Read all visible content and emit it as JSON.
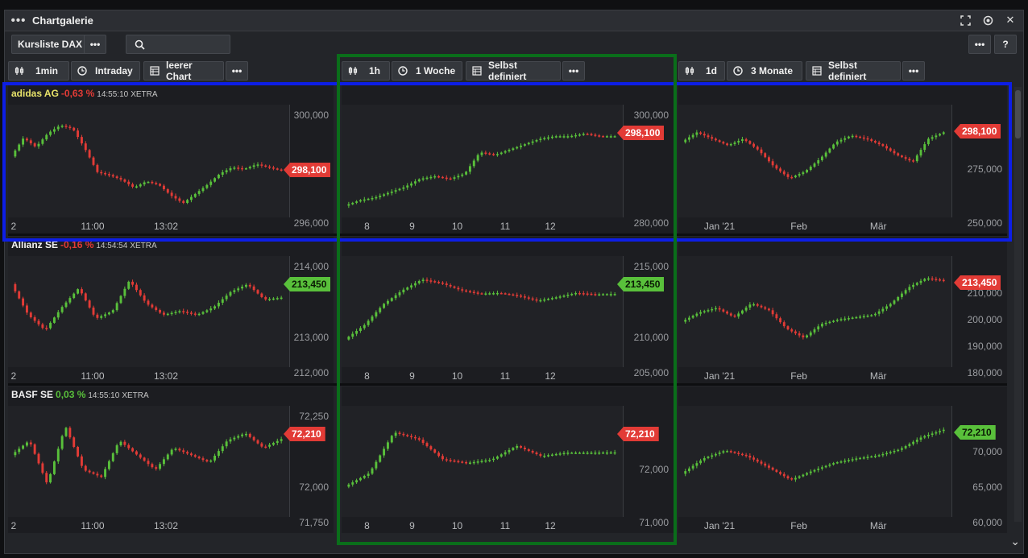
{
  "window": {
    "title": "Chartgalerie"
  },
  "toolbar": {
    "list_label": "Kursliste DAX",
    "more_label": "•••",
    "help_label": "?"
  },
  "search": {
    "placeholder": ""
  },
  "columns": [
    {
      "interval": "1min",
      "range": "Intraday",
      "layout": "leerer Chart",
      "more": "•••"
    },
    {
      "interval": "1h",
      "range": "1 Woche",
      "layout": "Selbst definiert",
      "more": "•••"
    },
    {
      "interval": "1d",
      "range": "3 Monate",
      "layout": "Selbst definiert",
      "more": "•••"
    }
  ],
  "colors": {
    "up": "#59c03b",
    "down": "#e23b36",
    "background": "#232529",
    "highlight_row": "#0d1ee6",
    "highlight_column": "#0a6e1a"
  },
  "rows": [
    {
      "name": "adidas AG",
      "change": "-0,63 %",
      "change_dir": "down",
      "time": "14:55:10",
      "exchange": "XETRA",
      "charts": [
        {
          "y_labels": [
            "300,000",
            "298,100",
            "296,000"
          ],
          "x_labels": [
            "2",
            "11:00",
            "13:02"
          ],
          "last": "298,100",
          "last_dir": "down",
          "ylim": [
            295.5,
            301.5
          ],
          "series": [
            299.0,
            300.2,
            299.6,
            300.5,
            301.0,
            300.8,
            299.5,
            298.0,
            297.8,
            297.5,
            297.0,
            297.4,
            297.2,
            296.5,
            296.0,
            296.6,
            297.2,
            297.9,
            298.3,
            298.2,
            298.5,
            298.3,
            298.1
          ]
        },
        {
          "y_labels": [
            "300,000",
            "298,100",
            "280,000"
          ],
          "x_labels": [
            "8",
            "9",
            "10",
            "11",
            "12"
          ],
          "last": "298,100",
          "last_dir": "down",
          "ylim": [
            270.0,
            305.0
          ],
          "series": [
            272,
            274,
            275,
            277,
            279,
            282,
            283,
            282,
            284,
            292,
            291,
            293,
            295,
            297,
            298,
            298,
            299,
            298,
            298
          ]
        },
        {
          "y_labels": [
            "298,100",
            "275,000",
            "250,000"
          ],
          "x_labels": [
            "Jan '21",
            "Feb",
            "Mär"
          ],
          "last": "298,100",
          "last_dir": "down",
          "ylim": [
            248.0,
            305.0
          ],
          "series": [
            290,
            296,
            292,
            288,
            292,
            285,
            275,
            268,
            272,
            280,
            290,
            294,
            292,
            288,
            282,
            278,
            292,
            296
          ]
        }
      ]
    },
    {
      "name": "Allianz SE",
      "change": "-0,16 %",
      "change_dir": "down",
      "time": "14:54:54",
      "exchange": "XETRA",
      "charts": [
        {
          "y_labels": [
            "214,000",
            "213,450",
            "213,000",
            "212,000"
          ],
          "x_labels": [
            "2",
            "11:00",
            "13:02"
          ],
          "last": "213,450",
          "last_dir": "up",
          "ylim": [
            211.8,
            214.2
          ],
          "series": [
            213.8,
            213.0,
            212.6,
            213.2,
            213.7,
            212.9,
            213.1,
            213.9,
            213.3,
            213.0,
            213.1,
            213.0,
            213.2,
            213.6,
            213.8,
            213.4,
            213.45
          ]
        },
        {
          "y_labels": [
            "215,000",
            "213,450",
            "210,000",
            "205,000"
          ],
          "x_labels": [
            "8",
            "9",
            "10",
            "11",
            "12"
          ],
          "last": "213,450",
          "last_dir": "up",
          "ylim": [
            204.0,
            217.0
          ],
          "series": [
            207,
            209,
            212,
            214,
            215.5,
            215,
            214,
            213.5,
            213.6,
            213.2,
            212.5,
            213,
            213.6,
            213.4,
            213.45
          ]
        },
        {
          "y_labels": [
            "213,450",
            "210,000",
            "200,000",
            "190,000",
            "180,000"
          ],
          "x_labels": [
            "Jan '21",
            "Feb",
            "Mär"
          ],
          "last": "213,450",
          "last_dir": "down",
          "ylim": [
            178.0,
            218.0
          ],
          "series": [
            195,
            199,
            201,
            197,
            203,
            200,
            192,
            188,
            194,
            196,
            197,
            198,
            203,
            210,
            214,
            213
          ]
        }
      ]
    },
    {
      "name": "BASF SE",
      "change": "0,03 %",
      "change_dir": "up",
      "time": "14:55:10",
      "exchange": "XETRA",
      "charts": [
        {
          "y_labels": [
            "72,250",
            "72,210",
            "72,000",
            "71,750"
          ],
          "x_labels": [
            "2",
            "11:00",
            "13:02"
          ],
          "last": "72,210",
          "last_dir": "down",
          "ylim": [
            71.72,
            72.35
          ],
          "series": [
            72.1,
            72.2,
            71.9,
            72.3,
            72.0,
            71.95,
            72.2,
            72.1,
            72.0,
            72.15,
            72.1,
            72.05,
            72.2,
            72.25,
            72.15,
            72.21
          ]
        },
        {
          "y_labels": [
            "72,210",
            "72,000",
            "71,000"
          ],
          "x_labels": [
            "8",
            "9",
            "10",
            "11",
            "12"
          ],
          "last": "72,210",
          "last_dir": "down",
          "ylim": [
            70.5,
            73.2
          ],
          "series": [
            71.2,
            71.6,
            72.8,
            72.6,
            72.0,
            71.9,
            72.0,
            72.4,
            72.1,
            72.2,
            72.2,
            72.21
          ]
        },
        {
          "y_labels": [
            "72,210",
            "70,000",
            "65,000",
            "60,000"
          ],
          "x_labels": [
            "Jan '21",
            "Feb",
            "Mär"
          ],
          "last": "72,210",
          "last_dir": "up",
          "ylim": [
            59.0,
            74.0
          ],
          "series": [
            65.0,
            67.5,
            68.8,
            67.9,
            66.0,
            64.0,
            65.5,
            66.8,
            67.5,
            68.0,
            69.0,
            71.0,
            72.2
          ]
        }
      ]
    }
  ]
}
